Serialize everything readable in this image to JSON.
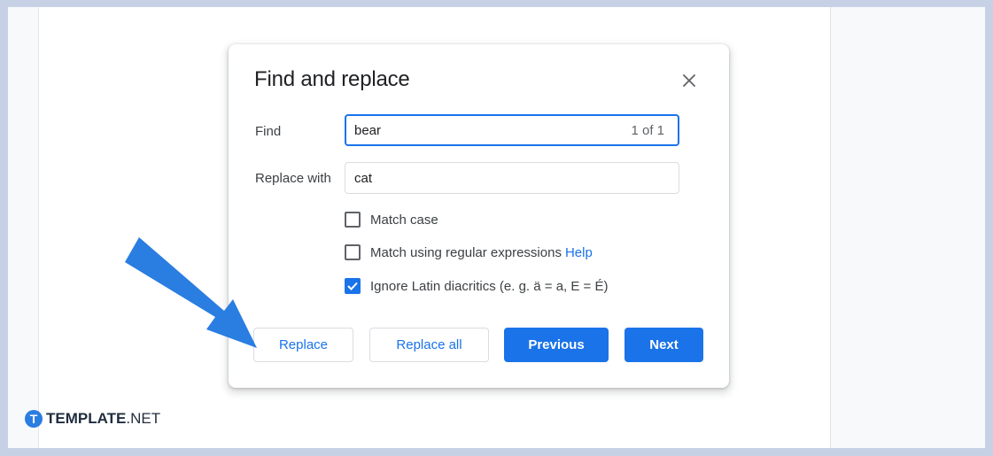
{
  "dialog": {
    "title": "Find and replace",
    "close_icon": "close-icon",
    "find": {
      "label": "Find",
      "value": "bear",
      "match_count": "1 of 1"
    },
    "replace": {
      "label": "Replace with",
      "value": "cat"
    },
    "options": [
      {
        "label": "Match case",
        "checked": false
      },
      {
        "label": "Match using regular expressions",
        "checked": false,
        "help_link": "Help"
      },
      {
        "label": "Ignore Latin diacritics (e. g. ä = a, E = É)",
        "checked": true
      }
    ],
    "buttons": {
      "replace": "Replace",
      "replace_all": "Replace all",
      "previous": "Previous",
      "next": "Next"
    }
  },
  "annotation": {
    "icon": "arrow-pointer-icon",
    "color": "#2a7de1"
  },
  "branding": {
    "badge": "T",
    "name_bold": "TEMPLATE",
    "name_suffix": ".NET"
  },
  "colors": {
    "accent": "#1a73e8",
    "background": "#c7d1e6"
  }
}
